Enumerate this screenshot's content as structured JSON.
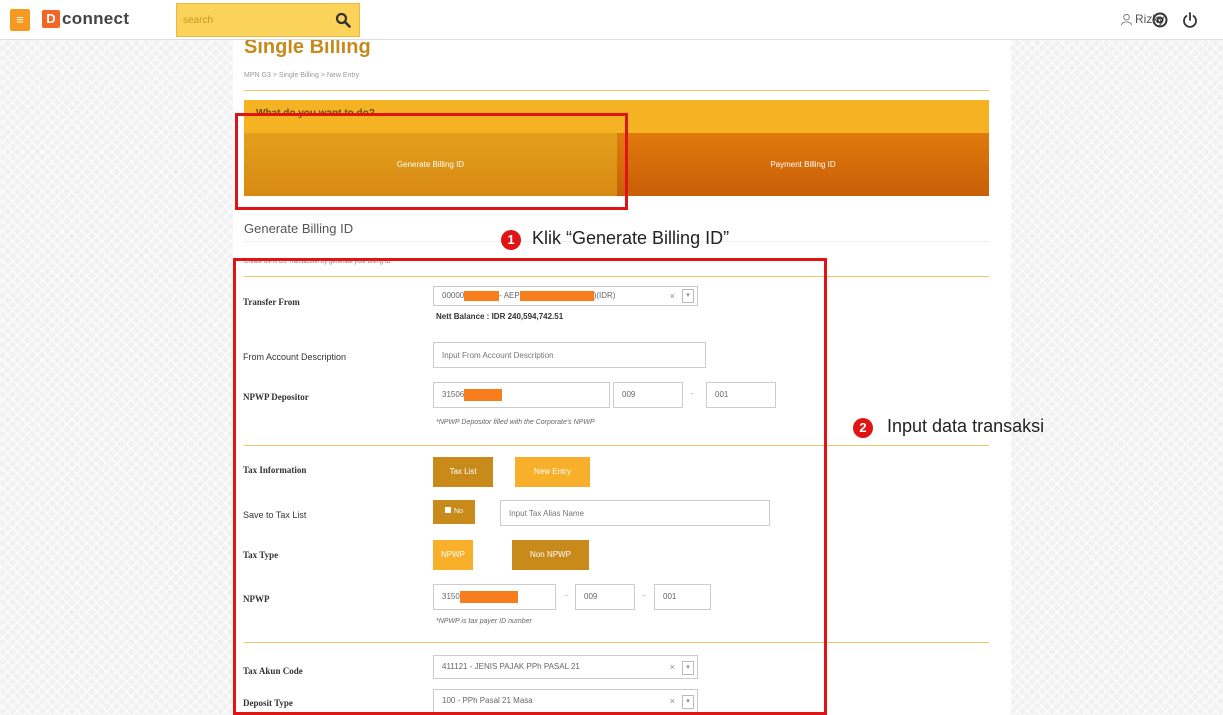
{
  "app": {
    "logo_letter": "D",
    "logo_name": "connect",
    "search_placeholder": "search",
    "user_name": "Rizky"
  },
  "page": {
    "title": "Single Billing",
    "breadcrumb": "MPN G3  >  Single Billing  >  New Entry",
    "wizard_header": "What do you want to do?",
    "tabs": {
      "generate": "Generate Billing ID",
      "payment": "Payment Billing ID"
    },
    "section_title": "Generate Billing ID",
    "section_subtitle": "Create MPN G3 Transaction by generate your billing ID"
  },
  "form": {
    "transfer_from": {
      "label": "Transfer From",
      "value_prefix": "00000",
      "value_mid": "- AEP",
      "value_suffix": ")(IDR)",
      "clear": "×",
      "balance": "Nett Balance : IDR 240,594,742.51"
    },
    "from_account_description": {
      "label": "From Account Description",
      "placeholder": "Input From Account Description"
    },
    "npwp_depositor": {
      "label": "NPWP Depositor",
      "part1": "31506",
      "part2": "009",
      "part3": "001",
      "dash": "-",
      "note": "*NPWP Depositor filled with the Corporate's NPWP"
    },
    "tax_information": {
      "label": "Tax Information",
      "tax_list_button": "Tax List",
      "new_entry_button": "New Entry"
    },
    "save_to_tax_list": {
      "label": "Save to Tax List",
      "toggle": "No",
      "placeholder": "Input Tax Alias Name"
    },
    "tax_type": {
      "label": "Tax Type",
      "npwp_button": "NPWP",
      "non_npwp_button": "Non NPWP"
    },
    "npwp": {
      "label": "NPWP",
      "part1": "3150",
      "part2": "009",
      "part3": "001",
      "dash": "-",
      "note": "*NPWP is tax payer ID number"
    },
    "tax_akun_code": {
      "label": "Tax Akun Code",
      "value": "411121 - JENIS PAJAK PPh PASAL 21",
      "clear": "×"
    },
    "deposit_type": {
      "label": "Deposit Type",
      "value": "100 - PPh Pasal 21 Masa",
      "clear": "×"
    }
  },
  "annotations": {
    "step1_number": "1",
    "step1_text": "Klik “Generate Billing ID”",
    "step2_number": "2",
    "step2_text": "Input data transaksi"
  },
  "colors": {
    "accent": "#f5b324",
    "annotation_red": "#e01414",
    "redaction": "#f77d1d"
  }
}
